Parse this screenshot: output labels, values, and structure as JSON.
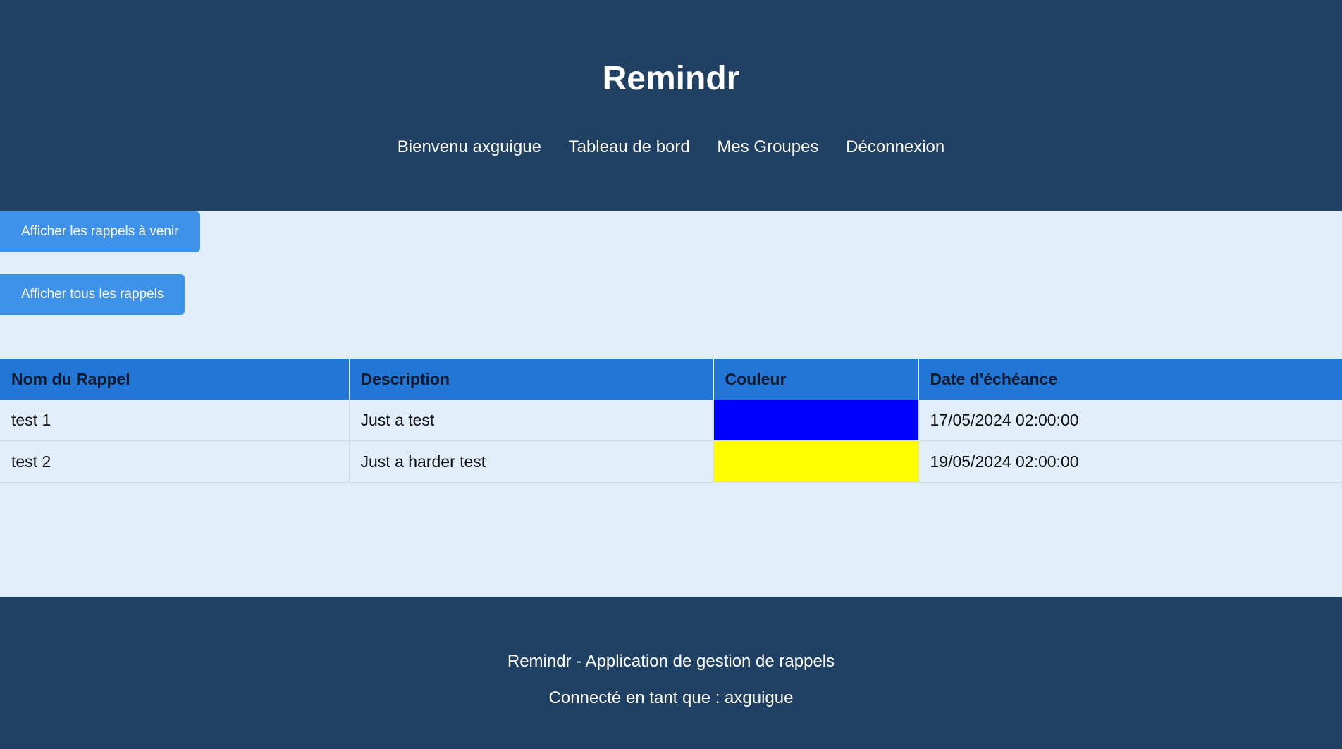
{
  "header": {
    "title": "Remindr",
    "nav": [
      {
        "label": "Bienvenu axguigue"
      },
      {
        "label": "Tableau de bord"
      },
      {
        "label": "Mes Groupes"
      },
      {
        "label": "Déconnexion"
      }
    ]
  },
  "actions": {
    "upcoming_label": "Afficher les rappels à venir",
    "all_label": "Afficher tous les rappels"
  },
  "table": {
    "headers": [
      "Nom du Rappel",
      "Description",
      "Couleur",
      "Date d'échéance"
    ],
    "rows": [
      {
        "name": "test 1",
        "description": "Just a test",
        "color": "#0000ff",
        "due": "17/05/2024 02:00:00"
      },
      {
        "name": "test 2",
        "description": "Just a harder test",
        "color": "#ffff00",
        "due": "19/05/2024 02:00:00"
      }
    ]
  },
  "footer": {
    "line1": "Remindr - Application de gestion de rappels",
    "line2": "Connecté en tant que : axguigue"
  },
  "colors": {
    "header_bg": "#204163",
    "button_bg": "#3e92ea",
    "table_header_bg": "#2277d6",
    "page_bg": "#e1eefa"
  }
}
